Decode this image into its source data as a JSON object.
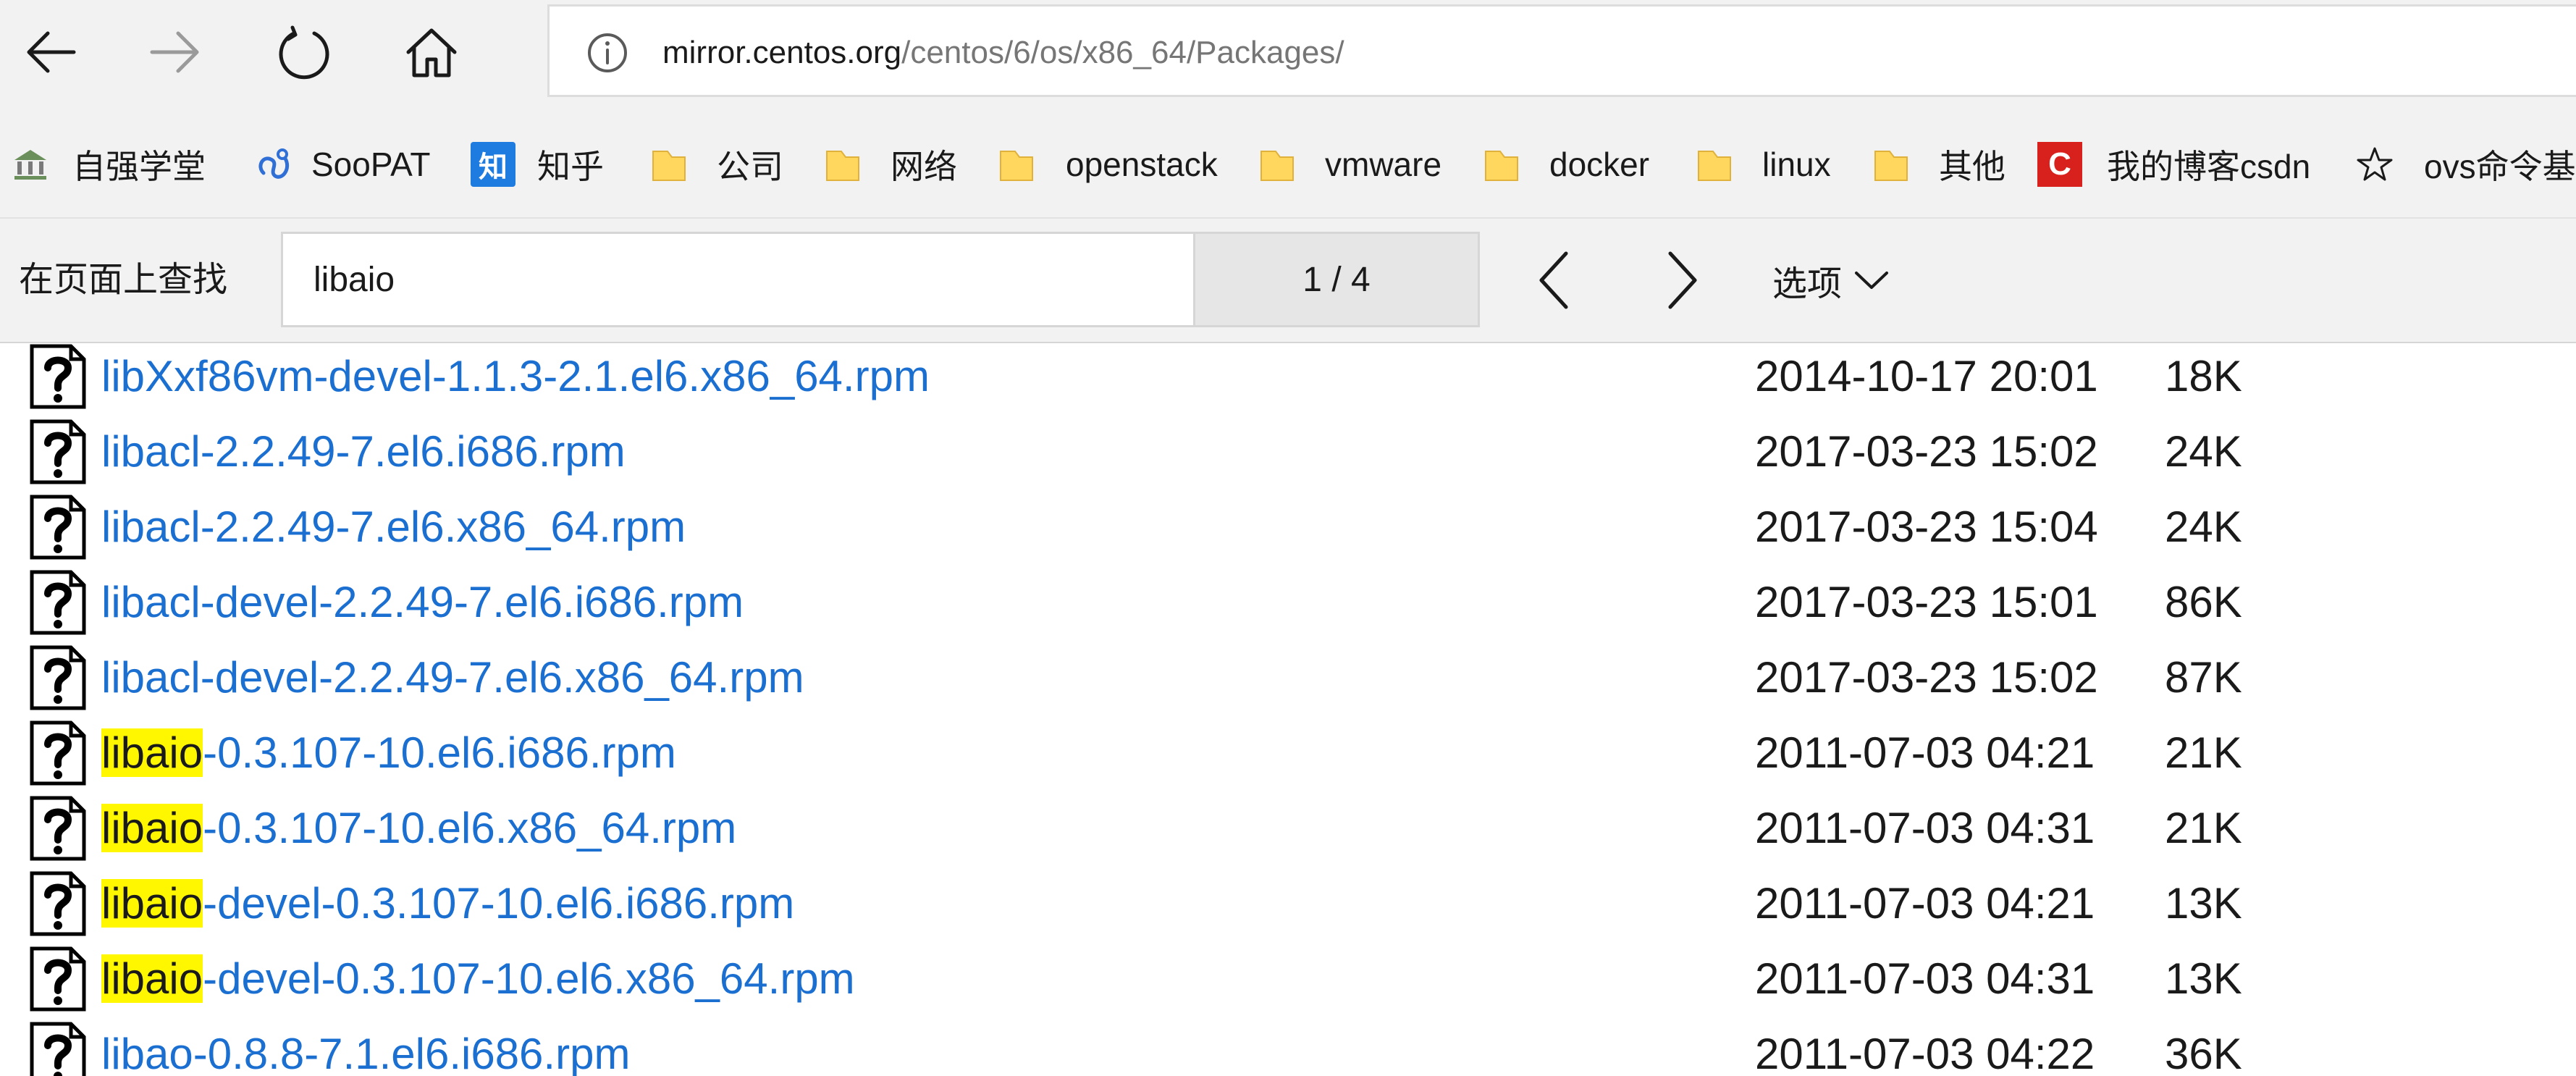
{
  "toolbar": {
    "url_host": "mirror.centos.org",
    "url_path": "/centos/6/os/x86_64/Packages/",
    "icons": [
      "back-arrow-icon",
      "forward-arrow-icon",
      "refresh-icon",
      "home-icon",
      "info-icon"
    ]
  },
  "bookmarks": [
    {
      "label": "自强学堂",
      "icon": "bank-icon"
    },
    {
      "label": "SooPAT",
      "icon": "soopat-icon"
    },
    {
      "label": "知乎",
      "icon": "zhihu-icon",
      "icon_text": "知"
    },
    {
      "label": "公司",
      "icon": "folder-icon"
    },
    {
      "label": "网络",
      "icon": "folder-icon"
    },
    {
      "label": "openstack",
      "icon": "folder-icon"
    },
    {
      "label": "vmware",
      "icon": "folder-icon"
    },
    {
      "label": "docker",
      "icon": "folder-icon"
    },
    {
      "label": "linux",
      "icon": "folder-icon"
    },
    {
      "label": "其他",
      "icon": "folder-icon"
    },
    {
      "label": "我的博客csdn",
      "icon": "csdn-icon",
      "icon_text": "C"
    },
    {
      "label": "ovs命令基",
      "icon": "star-icon"
    }
  ],
  "findbar": {
    "label": "在页面上查找",
    "query": "libaio",
    "count": "1 / 4",
    "options_label": "选项"
  },
  "colors": {
    "link": "#1a6fd1",
    "highlight": "#fff700",
    "chrome_bg": "#f2f2f2",
    "folder": "#ffd75e"
  },
  "files": [
    {
      "highlight": "",
      "name": "libXxf86vm-devel-1.1.3-2.1.el6.x86_64.rpm",
      "date": "2014-10-17 20:01",
      "size": "18K"
    },
    {
      "highlight": "",
      "name": "libacl-2.2.49-7.el6.i686.rpm",
      "date": "2017-03-23 15:02",
      "size": "24K"
    },
    {
      "highlight": "",
      "name": "libacl-2.2.49-7.el6.x86_64.rpm",
      "date": "2017-03-23 15:04",
      "size": "24K"
    },
    {
      "highlight": "",
      "name": "libacl-devel-2.2.49-7.el6.i686.rpm",
      "date": "2017-03-23 15:01",
      "size": "86K"
    },
    {
      "highlight": "",
      "name": "libacl-devel-2.2.49-7.el6.x86_64.rpm",
      "date": "2017-03-23 15:02",
      "size": "87K"
    },
    {
      "highlight": "libaio",
      "name": "-0.3.107-10.el6.i686.rpm",
      "date": "2011-07-03 04:21",
      "size": "21K"
    },
    {
      "highlight": "libaio",
      "name": "-0.3.107-10.el6.x86_64.rpm",
      "date": "2011-07-03 04:31",
      "size": "21K"
    },
    {
      "highlight": "libaio",
      "name": "-devel-0.3.107-10.el6.i686.rpm",
      "date": "2011-07-03 04:21",
      "size": "13K"
    },
    {
      "highlight": "libaio",
      "name": "-devel-0.3.107-10.el6.x86_64.rpm",
      "date": "2011-07-03 04:31",
      "size": "13K"
    },
    {
      "highlight": "",
      "name": "libao-0.8.8-7.1.el6.i686.rpm",
      "date": "2011-07-03 04:22",
      "size": "36K"
    }
  ]
}
